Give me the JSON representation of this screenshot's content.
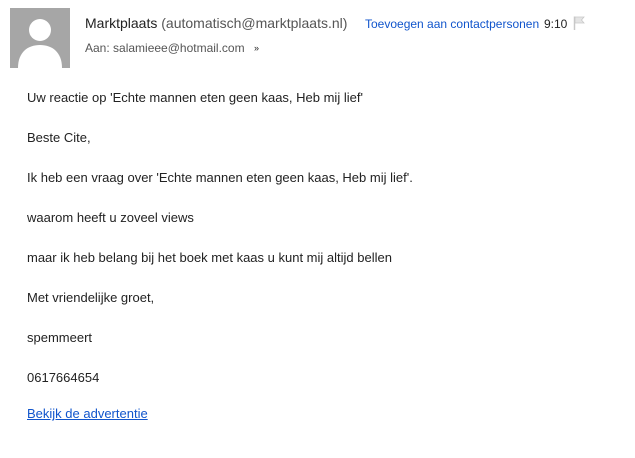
{
  "header": {
    "sender_name": "Marktplaats",
    "sender_email": "(automatisch@marktplaats.nl)",
    "add_contact_label": "Toevoegen aan contactpersonen",
    "time": "9:10",
    "recipient_prefix": "Aan:",
    "recipient": "salamieee@hotmail.com",
    "expand_icon": "double-chevron-down-icon",
    "flag_icon": "flag-icon",
    "avatar_icon": "default-user-silhouette-icon"
  },
  "message": {
    "lines": [
      "Uw reactie op 'Echte mannen eten geen kaas, Heb mij lief'",
      "Beste Cite,",
      "Ik heb een vraag over 'Echte mannen eten geen kaas, Heb mij lief'.",
      "waarom heeft u zoveel views",
      "maar ik heb belang bij het boek met kaas u kunt mij altijd bellen",
      "Met vriendelijke groet,",
      "spemmeert",
      "0617664654"
    ],
    "link_label": "Bekijk de advertentie"
  },
  "colors": {
    "link": "#1155cc",
    "text": "#222222",
    "muted": "#555555",
    "avatar_bg": "#a6a6a6"
  }
}
